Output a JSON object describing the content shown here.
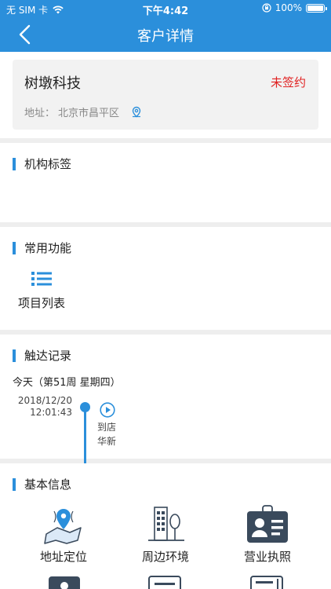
{
  "status_bar": {
    "carrier": "无 SIM 卡",
    "time": "下午4:42",
    "battery": "100%"
  },
  "nav": {
    "title": "客户详情"
  },
  "company": {
    "name": "树墩科技",
    "status": "未签约",
    "status_color": "#e02020",
    "address_label": "地址：",
    "address": "北京市昌平区"
  },
  "sections": {
    "tags": {
      "title": "机构标签"
    },
    "functions": {
      "title": "常用功能",
      "items": [
        {
          "label": "项目列表",
          "icon": "list-icon"
        }
      ]
    },
    "touch_records": {
      "title": "触达记录",
      "today_label": "今天（第51周 星期四）",
      "records": [
        {
          "date": "2018/12/20",
          "time": "12:01:43",
          "action": "到店",
          "person": "华新",
          "icon": "play-icon"
        }
      ]
    },
    "basic_info": {
      "title": "基本信息",
      "items": [
        {
          "label": "地址定位",
          "icon": "map-pin-icon"
        },
        {
          "label": "周边环境",
          "icon": "building-icon"
        },
        {
          "label": "营业执照",
          "icon": "id-badge-icon"
        }
      ]
    }
  },
  "colors": {
    "accent": "#2b8fdb",
    "background": "#eeeeee",
    "card": "#f2f2f2"
  }
}
